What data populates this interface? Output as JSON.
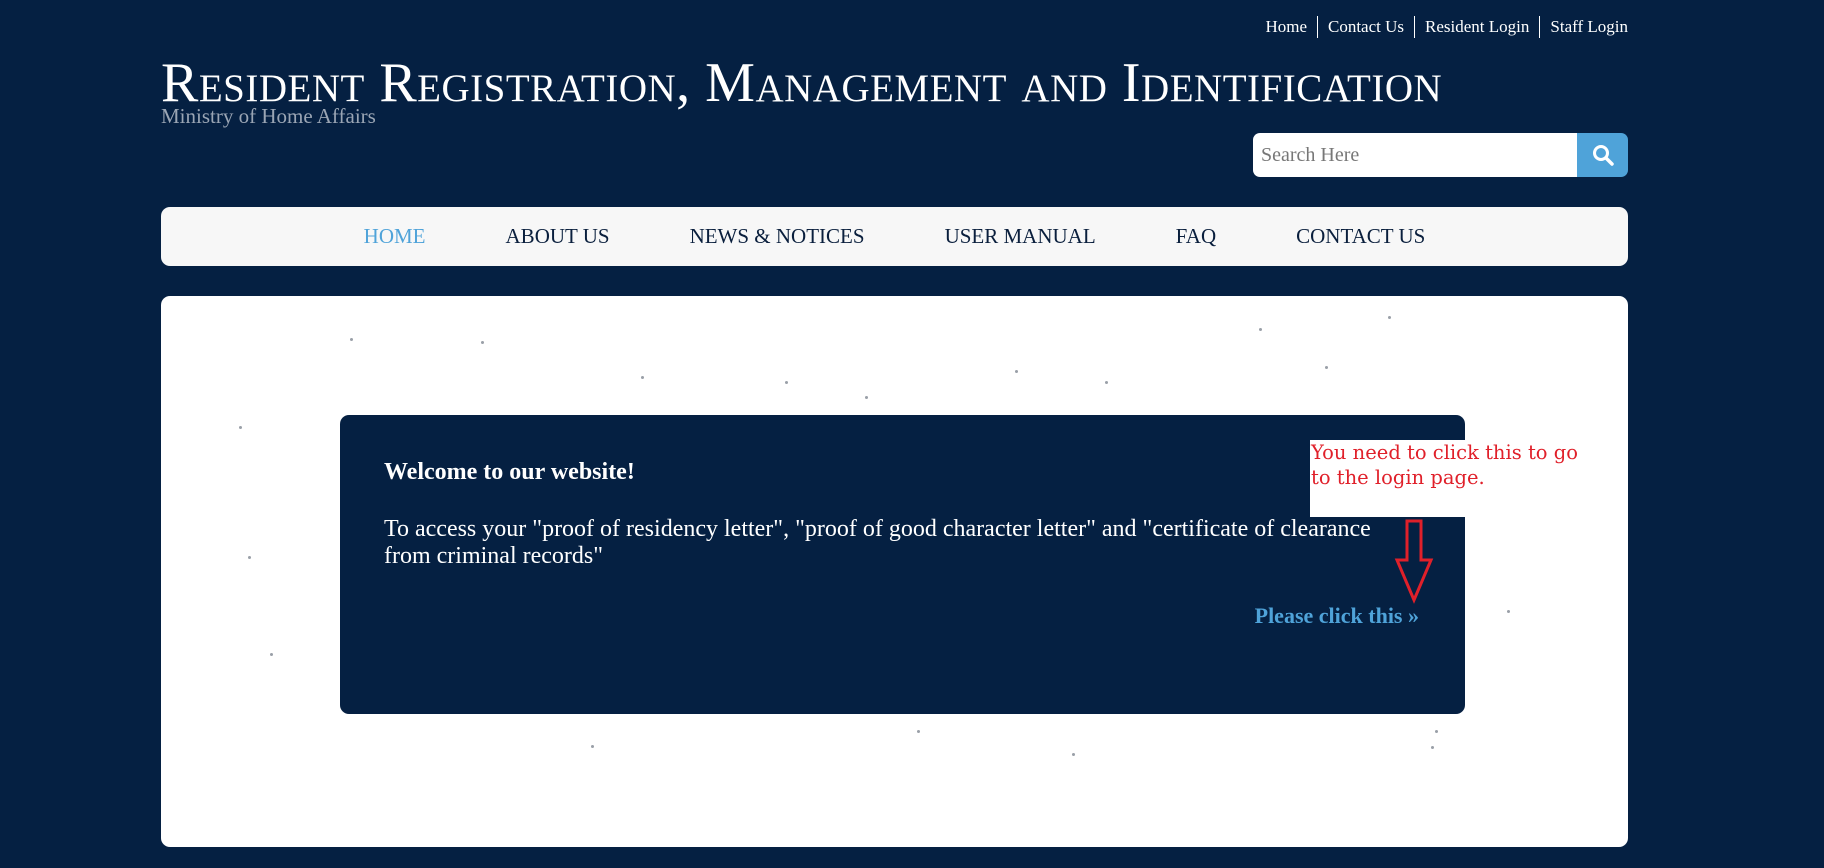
{
  "top_links": [
    "Home",
    "Contact Us",
    "Resident Login",
    "Staff Login"
  ],
  "site": {
    "title": "Resident Registration, Management and Identification",
    "subtitle": "Ministry of Home Affairs"
  },
  "search": {
    "placeholder": "Search Here",
    "button_icon": "search-icon"
  },
  "nav": {
    "items": [
      "HOME",
      "ABOUT US",
      "NEWS & NOTICES",
      "USER MANUAL",
      "FAQ",
      "CONTACT US"
    ],
    "active": "HOME"
  },
  "welcome": {
    "title": "Welcome to our website!",
    "text": "To access your \"proof of residency letter\", \"proof of good character letter\" and \"certificate of clearance from criminal records\"",
    "link": "Please click this »"
  },
  "annotation": {
    "text": "You need to click this to go to the login page.",
    "color": "#e0202a",
    "arrow_icon": "down-arrow-icon"
  },
  "colors": {
    "background": "#052042",
    "accent": "#4fa3d9",
    "nav_background": "#f7f7f7"
  }
}
